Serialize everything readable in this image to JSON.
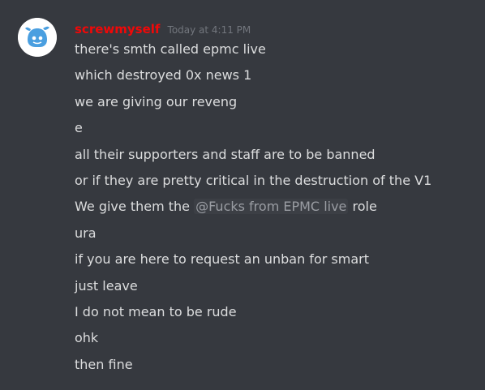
{
  "message": {
    "author": "screwmyself",
    "timestamp": "Today at 4:11 PM",
    "author_color": "#f00808",
    "avatar_icon": "discord-logo-avatar-icon",
    "lines": [
      "there's smth called epmc live",
      "which destroyed 0x news 1",
      "we are giving our reveng",
      "e",
      "all their supporters and staff are to be banned",
      "or if they are pretty critical in the destruction of the V1",
      "We give them the",
      "ura",
      "if you are here to request an unban for smart",
      "just leave",
      "I do not mean to be rude",
      "ohk",
      "then fine"
    ],
    "mention_role": "@Fucks from EPMC live",
    "mention_suffix": " role"
  },
  "colors": {
    "background": "#36393f",
    "text": "#dcddde",
    "timestamp": "#72767d",
    "mention_bg": "#3c3f45"
  }
}
